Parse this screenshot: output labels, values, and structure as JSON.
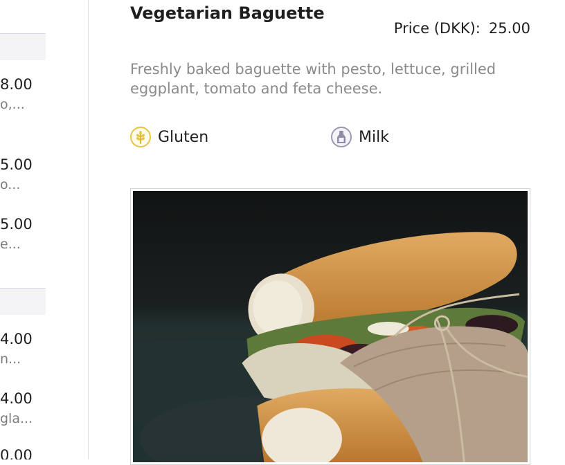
{
  "item": {
    "title": "Vegetarian Baguette",
    "price_label": "Price (DKK):",
    "price_value": "25.00",
    "description": "Freshly baked baguette with pesto, lettuce, grilled eggplant, tomato and feta cheese.",
    "allergens": [
      {
        "label": "Gluten",
        "icon": "wheat-icon",
        "color": "#e6c446"
      },
      {
        "label": "Milk",
        "icon": "milk-bottle-icon",
        "color": "#9a99b3"
      }
    ]
  },
  "left_list": {
    "items": [
      {
        "price": "8.00",
        "desc": "o,..."
      },
      {
        "price": "5.00",
        "desc": "o..."
      },
      {
        "price": "5.00",
        "desc": "e..."
      },
      {
        "price": "4.00",
        "desc": "n..."
      },
      {
        "price": "4.00",
        "desc": "gla..."
      },
      {
        "price": "0.00",
        "desc": ""
      }
    ]
  }
}
